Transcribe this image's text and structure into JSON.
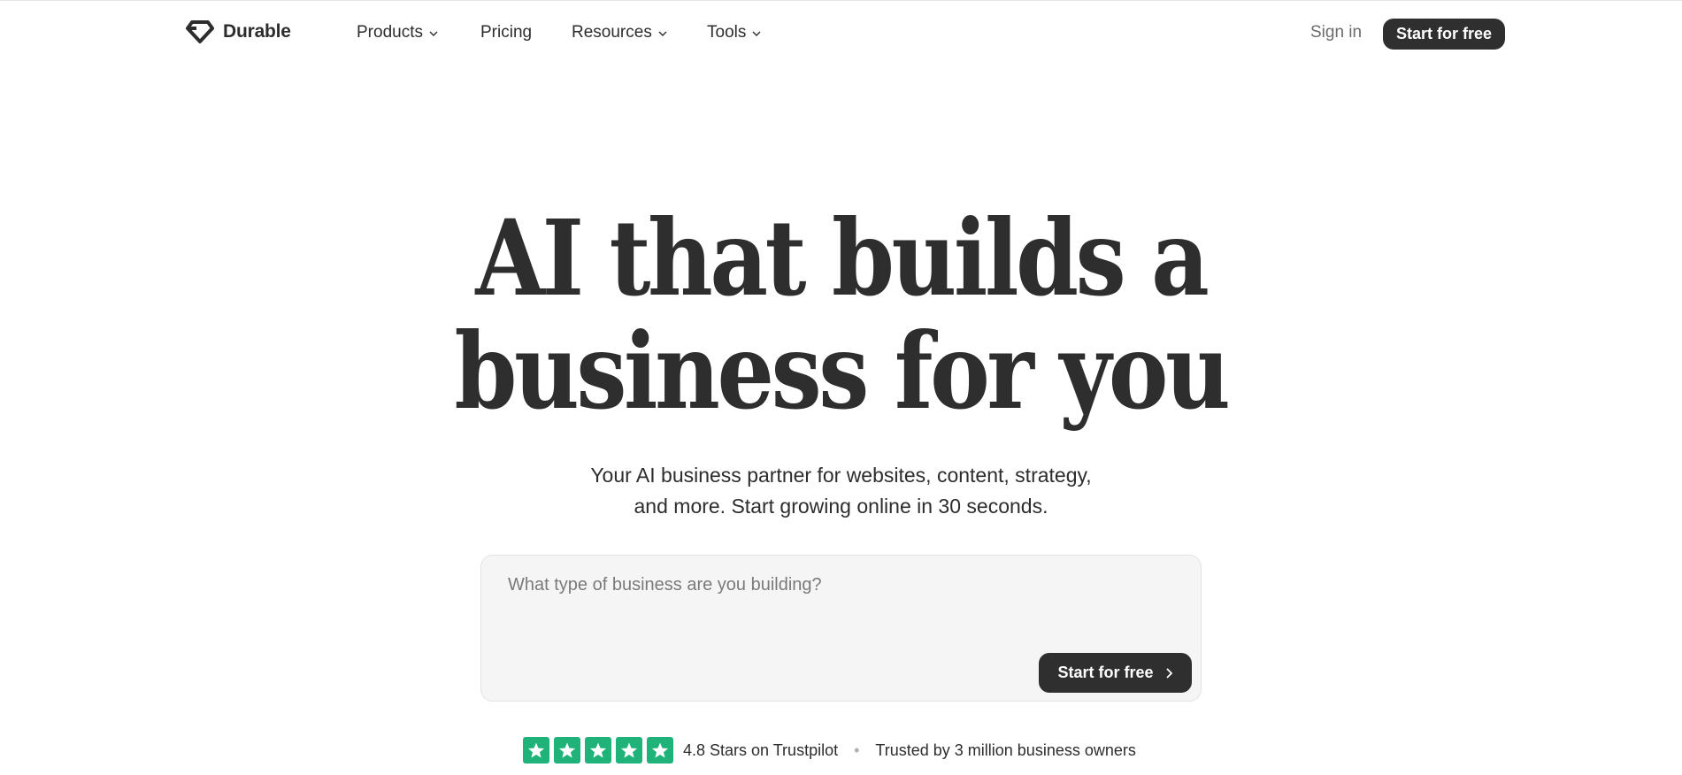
{
  "brand": {
    "name": "Durable"
  },
  "nav": {
    "items": [
      {
        "label": "Products",
        "dropdown": true
      },
      {
        "label": "Pricing",
        "dropdown": false
      },
      {
        "label": "Resources",
        "dropdown": true
      },
      {
        "label": "Tools",
        "dropdown": true
      }
    ],
    "sign_in": "Sign in",
    "cta": "Start for free"
  },
  "hero": {
    "title_line1": "AI that builds a",
    "title_line2": "business for you",
    "subtitle_line1": "Your AI business partner for websites, content, strategy,",
    "subtitle_line2": "and more. Start growing online in 30 seconds."
  },
  "prompt": {
    "placeholder": "What type of business are you building?",
    "value": "",
    "cta": "Start for free"
  },
  "trust": {
    "rating_text": "4.8 Stars on Trustpilot",
    "stars": 5,
    "separator": "•",
    "trusted_text": "Trusted by 3 million business owners"
  },
  "colors": {
    "dark": "#2f2f2f",
    "trustpilot_green": "#1fb37a",
    "prompt_bg": "#f5f5f5"
  },
  "icons": {
    "logo": "diamond-logo-icon",
    "dropdown": "chevron-down-icon",
    "cta_arrow": "chevron-right-icon",
    "rating": "star-icon"
  }
}
